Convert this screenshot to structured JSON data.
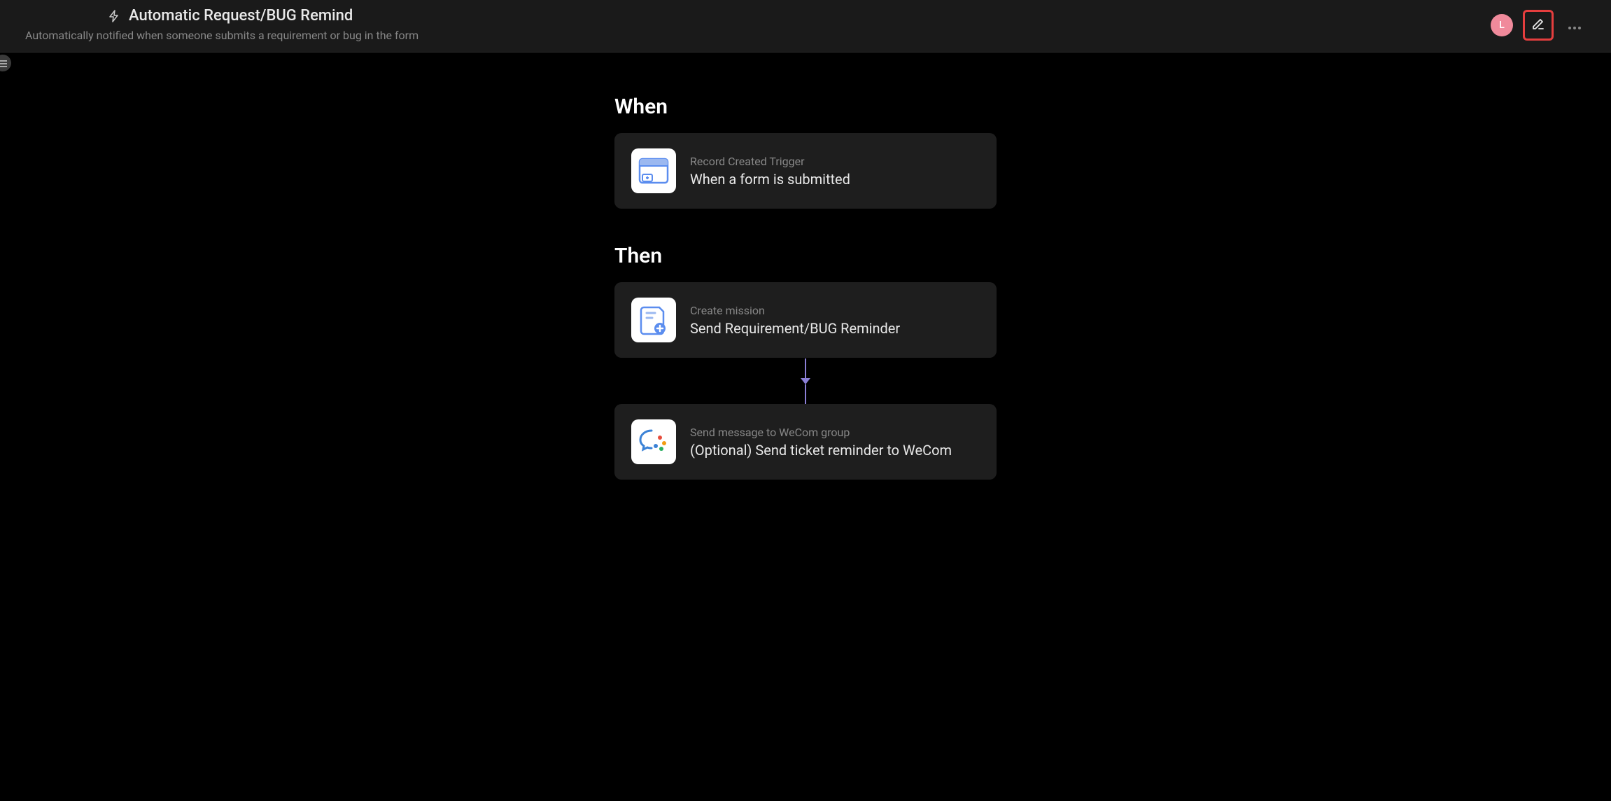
{
  "header": {
    "title": "Automatic Request/BUG Remind",
    "subtitle": "Automatically notified when someone submits a requirement or bug in the form",
    "avatar_letter": "L"
  },
  "sections": {
    "when": {
      "title": "When",
      "card": {
        "label": "Record Created Trigger",
        "title": "When a form is submitted"
      }
    },
    "then": {
      "title": "Then",
      "cards": [
        {
          "label": "Create mission",
          "title": "Send Requirement/BUG Reminder"
        },
        {
          "label": "Send message to WeCom group",
          "title": "(Optional) Send ticket reminder to WeCom"
        }
      ]
    }
  }
}
